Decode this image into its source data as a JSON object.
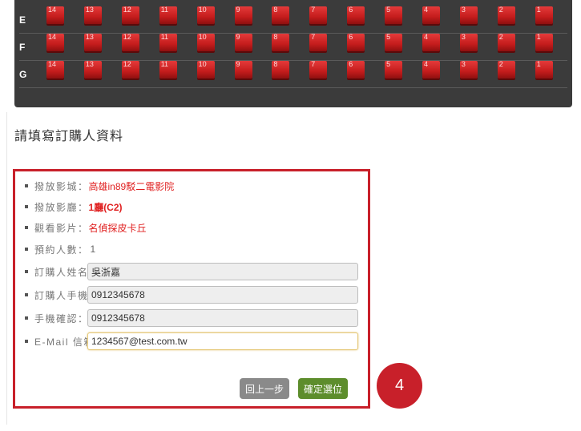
{
  "seatmap": {
    "rows": [
      {
        "label": "E",
        "seats": [
          "14",
          "13",
          "12",
          "11",
          "10",
          "9",
          "8",
          "7",
          "6",
          "5",
          "4",
          "3",
          "2",
          "1"
        ]
      },
      {
        "label": "F",
        "seats": [
          "14",
          "13",
          "12",
          "11",
          "10",
          "9",
          "8",
          "7",
          "6",
          "5",
          "4",
          "3",
          "2",
          "1"
        ]
      },
      {
        "label": "G",
        "seats": [
          "14",
          "13",
          "12",
          "11",
          "10",
          "9",
          "8",
          "7",
          "6",
          "5",
          "4",
          "3",
          "2",
          "1"
        ]
      }
    ],
    "seat_color": "#c41c1c",
    "panel_color": "#3b3b3b"
  },
  "section_title": "請填寫訂購人資料",
  "form": {
    "cinema": {
      "label": "撥放影城：",
      "value": "高雄in89駁二電影院"
    },
    "hall": {
      "label": "撥放影廳：",
      "value": "1廳(C2)"
    },
    "movie": {
      "label": "觀看影片：",
      "value": "名偵探皮卡丘"
    },
    "people": {
      "label": "預約人數：",
      "value": "1"
    },
    "name": {
      "label": "訂購人姓名：",
      "value": "吳浙嘉"
    },
    "phone": {
      "label": "訂購人手機：",
      "value": "0912345678"
    },
    "phone_confirm": {
      "label": "手機確認：",
      "value": "0912345678"
    },
    "email": {
      "label": "E-Mail 信箱：",
      "value": "1234567@test.com.tw"
    },
    "back_label": "回上一步",
    "confirm_label": "確定選位"
  },
  "step_number": "4",
  "colors": {
    "accent_red": "#c8202a",
    "confirm_green": "#5d8d2c",
    "back_gray": "#8a8a8a"
  }
}
